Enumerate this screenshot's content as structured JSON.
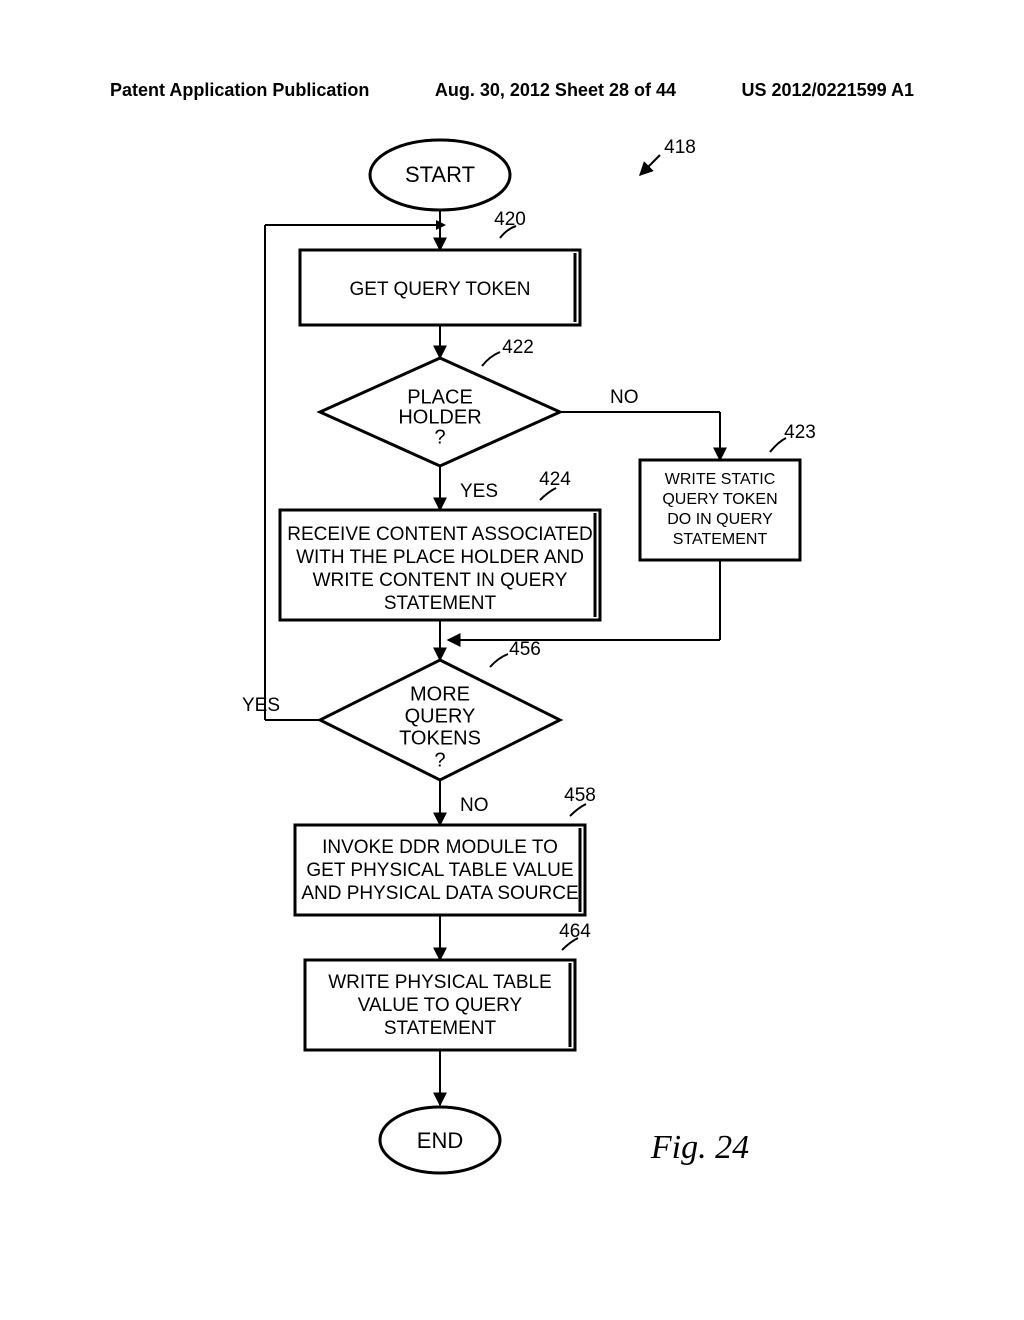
{
  "header": {
    "left": "Patent Application Publication",
    "center": "Aug. 30, 2012  Sheet 28 of 44",
    "right": "US 2012/0221599 A1"
  },
  "nodes": {
    "start": "START",
    "end": "END",
    "get_query_token": "GET QUERY TOKEN",
    "placeholder_q": "PLACE\nHOLDER\n?",
    "write_static": "WRITE STATIC\nQUERY TOKEN\nDO IN QUERY\nSTATEMENT",
    "receive_content": "RECEIVE CONTENT ASSOCIATED\nWITH THE PLACE HOLDER AND\nWRITE CONTENT IN QUERY\nSTATEMENT",
    "more_tokens": "MORE\nQUERY\nTOKENS\n?",
    "invoke_ddr": "INVOKE DDR MODULE TO\nGET PHYSICAL TABLE VALUE\nAND PHYSICAL DATA SOURCE",
    "write_physical": "WRITE PHYSICAL TABLE\nVALUE TO QUERY\nSTATEMENT"
  },
  "labels": {
    "yes": "YES",
    "no": "NO"
  },
  "callouts": {
    "n418": "418",
    "n420": "420",
    "n422": "422",
    "n423": "423",
    "n424": "424",
    "n456": "456",
    "n458": "458",
    "n464": "464"
  },
  "figure": "Fig. 24",
  "chart_data": {
    "type": "table",
    "title": "Flowchart: Query statement construction",
    "nodes": [
      {
        "id": "start",
        "type": "terminator",
        "label": "START"
      },
      {
        "id": "420",
        "type": "process",
        "label": "GET QUERY TOKEN"
      },
      {
        "id": "422",
        "type": "decision",
        "label": "PLACE HOLDER ?"
      },
      {
        "id": "423",
        "type": "process",
        "label": "WRITE STATIC QUERY TOKEN DO IN QUERY STATEMENT"
      },
      {
        "id": "424",
        "type": "process",
        "label": "RECEIVE CONTENT ASSOCIATED WITH THE PLACE HOLDER AND WRITE CONTENT IN QUERY STATEMENT"
      },
      {
        "id": "456",
        "type": "decision",
        "label": "MORE QUERY TOKENS ?"
      },
      {
        "id": "458",
        "type": "process",
        "label": "INVOKE DDR MODULE TO GET PHYSICAL TABLE VALUE AND PHYSICAL DATA SOURCE"
      },
      {
        "id": "464",
        "type": "process",
        "label": "WRITE PHYSICAL TABLE VALUE TO QUERY STATEMENT"
      },
      {
        "id": "end",
        "type": "terminator",
        "label": "END"
      }
    ],
    "edges": [
      {
        "from": "start",
        "to": "420"
      },
      {
        "from": "420",
        "to": "422"
      },
      {
        "from": "422",
        "to": "424",
        "label": "YES"
      },
      {
        "from": "422",
        "to": "423",
        "label": "NO"
      },
      {
        "from": "424",
        "to": "456"
      },
      {
        "from": "423",
        "to": "456"
      },
      {
        "from": "456",
        "to": "420",
        "label": "YES"
      },
      {
        "from": "456",
        "to": "458",
        "label": "NO"
      },
      {
        "from": "458",
        "to": "464"
      },
      {
        "from": "464",
        "to": "end"
      }
    ],
    "figure_ref": "418",
    "figure_label": "Fig. 24"
  }
}
